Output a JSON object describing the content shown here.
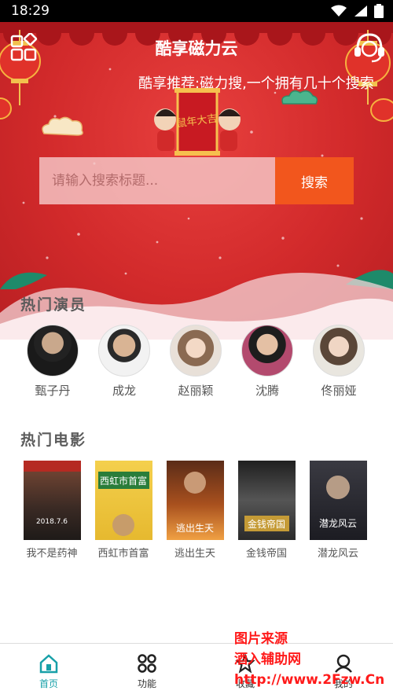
{
  "status_bar": {
    "time": "18:29"
  },
  "header": {
    "title": "酷享磁力云",
    "marquee": "酷享推荐:磁力搜,一个拥有几十个搜索",
    "banner_text": "鼠年大吉"
  },
  "search": {
    "placeholder": "请输入搜索标题...",
    "button_label": "搜索"
  },
  "actors_section": {
    "title": "热门演员",
    "items": [
      {
        "name": "甄子丹"
      },
      {
        "name": "成龙"
      },
      {
        "name": "赵丽颖"
      },
      {
        "name": "沈腾"
      },
      {
        "name": "佟丽娅"
      }
    ]
  },
  "movies_section": {
    "title": "热门电影",
    "items": [
      {
        "title": "我不是药神",
        "poster_text": "2018.7.6",
        "color": "#6a3f2e"
      },
      {
        "title": "西虹市首富",
        "poster_text": "西虹市首富",
        "color": "#e6c23c"
      },
      {
        "title": "逃出生天",
        "poster_text": "逃出生天",
        "color": "#7a3a1e"
      },
      {
        "title": "金钱帝国",
        "poster_text": "金钱帝国",
        "color": "#3b3b3b"
      },
      {
        "title": "潜龙风云",
        "poster_text": "潜龙风云",
        "color": "#2b2b2f"
      }
    ]
  },
  "tabbar": {
    "items": [
      {
        "label": "首页"
      },
      {
        "label": "功能"
      },
      {
        "label": "收藏"
      },
      {
        "label": "我的"
      }
    ]
  },
  "watermark": {
    "line1": "图片来源",
    "line2": "酒入辅助网",
    "line3": "http://www.2Fzw.Cn"
  },
  "colors": {
    "accent": "#17a0a8",
    "search_button": "#f2561d",
    "hero_red": "#d22a2b"
  }
}
